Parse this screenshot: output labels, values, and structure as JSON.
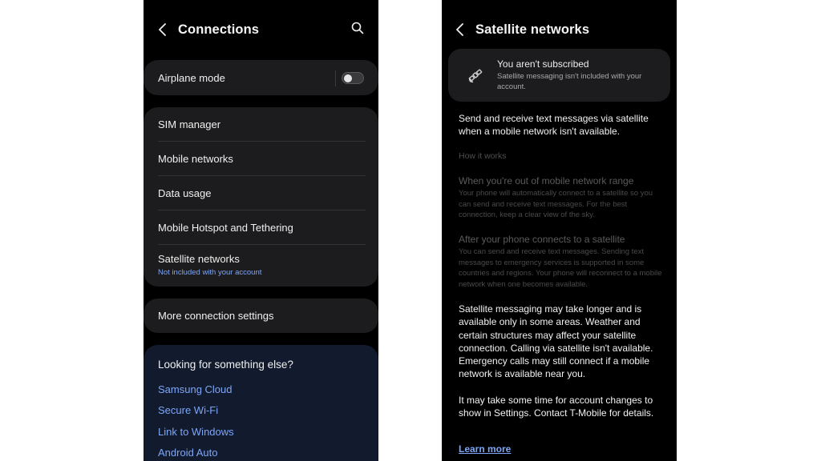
{
  "left": {
    "title": "Connections",
    "airplane": {
      "label": "Airplane mode",
      "enabled": false
    },
    "menu": [
      {
        "label": "SIM manager"
      },
      {
        "label": "Mobile networks"
      },
      {
        "label": "Data usage"
      },
      {
        "label": "Mobile Hotspot and Tethering"
      },
      {
        "label": "Satellite networks",
        "sub": "Not included with your account"
      }
    ],
    "more": "More connection settings",
    "suggest": {
      "title": "Looking for something else?",
      "links": [
        "Samsung Cloud",
        "Secure Wi-Fi",
        "Link to Windows",
        "Android Auto"
      ]
    }
  },
  "right": {
    "title": "Satellite networks",
    "banner": {
      "title": "You aren't subscribed",
      "text": "Satellite messaging isn't included with your account."
    },
    "intro": "Send and receive text messages via satellite when a mobile network isn't available.",
    "how_label": "How it works",
    "steps": [
      {
        "title": "When you're out of mobile network range",
        "text": "Your phone will automatically connect to a satellite so you can send and receive text messages. For the best connection, keep a clear view of the sky."
      },
      {
        "title": "After your phone connects to a satellite",
        "text": "You can send and receive text messages. Sending text messages to emergency services is supported in some countries and regions. Your phone will reconnect to a mobile network when one becomes available."
      }
    ],
    "note1": "Satellite messaging may take longer and is available only in some areas. Weather and certain structures may affect your satellite connection. Calling via satellite isn't available. Emergency calls may still connect if a mobile network is available near you.",
    "note2": "It may take some time for account changes to show in Settings. Contact T-Mobile for details.",
    "learn_more": "Learn more"
  },
  "icons": [
    "back-icon",
    "search-icon",
    "satellite-icon"
  ],
  "colors": {
    "accent": "#7ea6f7",
    "card": "#1c1c1e",
    "suggest_card": "#121a2d",
    "background": "#000000"
  }
}
